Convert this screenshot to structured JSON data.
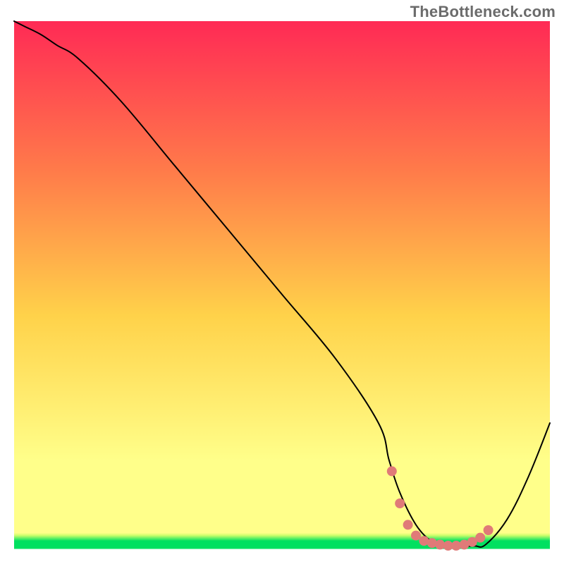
{
  "watermark": "TheBottleneck.com",
  "chart_data": {
    "type": "line",
    "title": "",
    "xlabel": "",
    "ylabel": "",
    "xlim": [
      0,
      100
    ],
    "ylim": [
      0,
      100
    ],
    "grid": false,
    "legend": null,
    "background_gradient": {
      "top": "#ff2a55",
      "mid_upper": "#ff7b4a",
      "mid": "#ffd24a",
      "mid_lower": "#ffff8a",
      "bottom_band": "#00e060",
      "bottom_edge": "#ffffff"
    },
    "series": [
      {
        "name": "bottleneck-curve",
        "color": "#000000",
        "stroke_width": 2,
        "x": [
          0,
          2,
          5,
          8,
          12,
          20,
          30,
          40,
          50,
          60,
          68,
          70,
          72,
          75,
          78,
          80,
          82,
          84,
          86,
          88,
          92,
          96,
          100
        ],
        "y": [
          100,
          99,
          97.5,
          95.5,
          93,
          85,
          73,
          61,
          49,
          37,
          25,
          18,
          12,
          6,
          2.8,
          2.1,
          2.05,
          2.0,
          2.05,
          2.3,
          7,
          15,
          25
        ]
      },
      {
        "name": "sweet-spot-markers",
        "color": "#e07a78",
        "marker_radius": 7,
        "x": [
          70.5,
          72,
          73.5,
          75,
          76.5,
          78,
          79.5,
          81,
          82.5,
          84,
          85.5,
          87,
          88.5
        ],
        "y": [
          16,
          10,
          6,
          4,
          3,
          2.6,
          2.3,
          2.1,
          2.1,
          2.3,
          2.8,
          3.6,
          5
        ]
      }
    ]
  }
}
